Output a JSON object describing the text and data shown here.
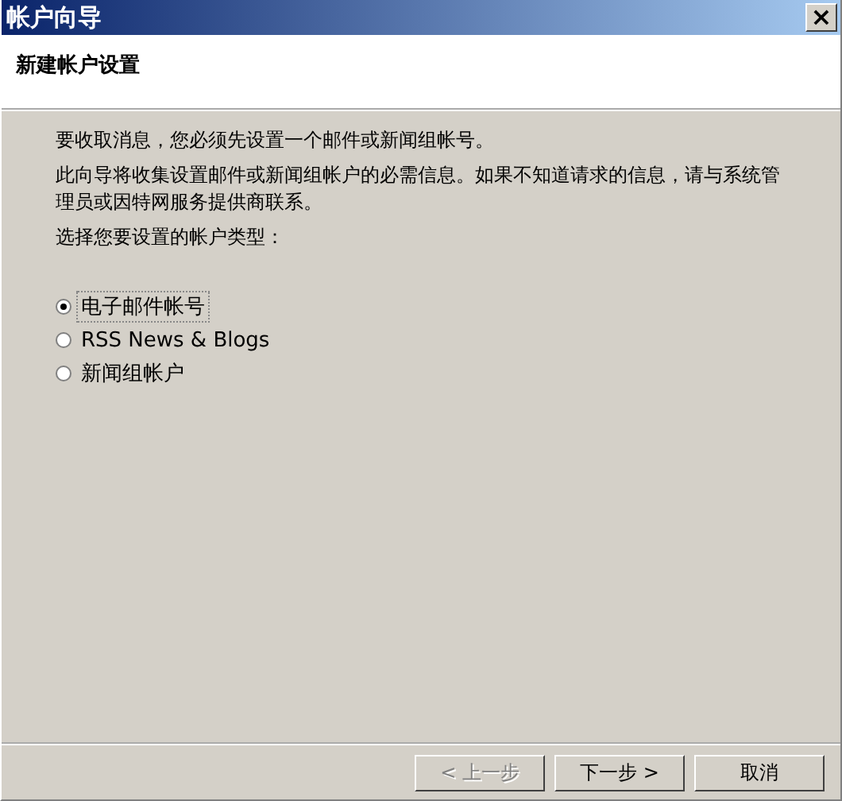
{
  "window": {
    "title": "帐户向导",
    "close": "×"
  },
  "header": {
    "title": "新建帐户设置"
  },
  "paragraphs": [
    "要收取消息，您必须先设置一个邮件或新闻组帐号。",
    "此向导将收集设置邮件或新闻组帐户的必需信息。如果不知道请求的信息，请与系统管理员或因特网服务提供商联系。",
    "选择您要设置的帐户类型："
  ],
  "options": [
    {
      "label": "电子邮件帐号",
      "selected": true
    },
    {
      "label": "RSS News & Blogs",
      "selected": false
    },
    {
      "label": "新闻组帐户",
      "selected": false
    }
  ],
  "buttons": [
    {
      "label": "< 上一步",
      "disabled": true
    },
    {
      "label": "下一步 >",
      "disabled": false
    },
    {
      "label": "取消",
      "disabled": false
    }
  ]
}
